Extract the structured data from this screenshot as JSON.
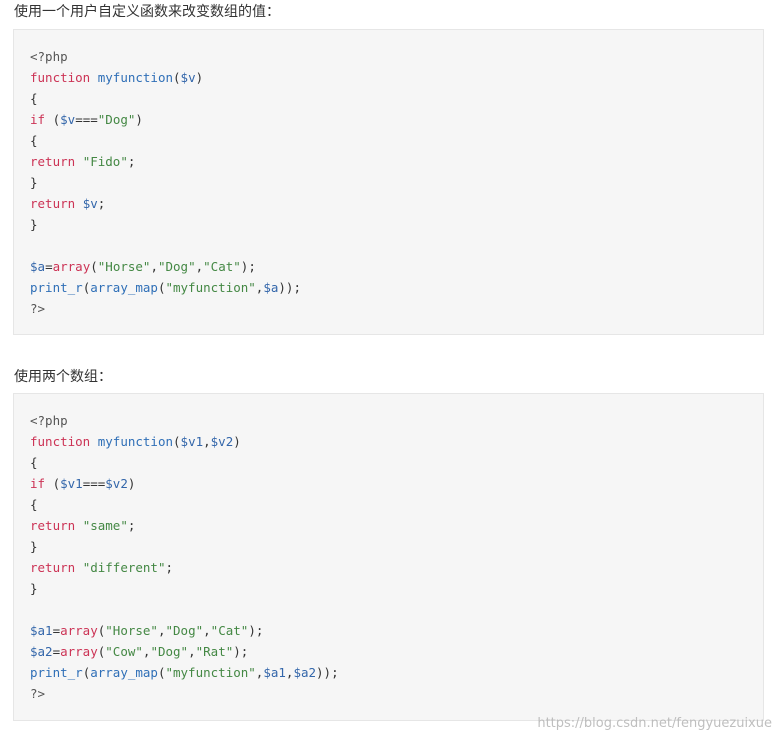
{
  "heading1": "使用一个用户自定义函数来改变数组的值：",
  "heading2": "使用两个数组：",
  "watermark": "https://blog.csdn.net/fengyuezuixue",
  "colors": {
    "keyword": "#cc3355",
    "function_name": "#2f6fb7",
    "variable": "#3366aa",
    "string": "#448844",
    "plain": "#333333",
    "code_background": "#f6f6f6"
  },
  "code1": [
    [
      {
        "t": "meta",
        "v": "<?php"
      }
    ],
    [
      {
        "t": "kw",
        "v": "function"
      },
      {
        "t": "plain",
        "v": " "
      },
      {
        "t": "fn",
        "v": "myfunction"
      },
      {
        "t": "plain",
        "v": "("
      },
      {
        "t": "var",
        "v": "$v"
      },
      {
        "t": "plain",
        "v": ")"
      }
    ],
    [
      {
        "t": "plain",
        "v": "{"
      }
    ],
    [
      {
        "t": "kw",
        "v": "if"
      },
      {
        "t": "plain",
        "v": " ("
      },
      {
        "t": "var",
        "v": "$v"
      },
      {
        "t": "plain",
        "v": "==="
      },
      {
        "t": "str",
        "v": "\"Dog\""
      },
      {
        "t": "plain",
        "v": ")"
      }
    ],
    [
      {
        "t": "plain",
        "v": "{"
      }
    ],
    [
      {
        "t": "kw",
        "v": "return"
      },
      {
        "t": "plain",
        "v": " "
      },
      {
        "t": "str",
        "v": "\"Fido\""
      },
      {
        "t": "plain",
        "v": ";"
      }
    ],
    [
      {
        "t": "plain",
        "v": "}"
      }
    ],
    [
      {
        "t": "kw",
        "v": "return"
      },
      {
        "t": "plain",
        "v": " "
      },
      {
        "t": "var",
        "v": "$v"
      },
      {
        "t": "plain",
        "v": ";"
      }
    ],
    [
      {
        "t": "plain",
        "v": "}"
      }
    ],
    [],
    [
      {
        "t": "var",
        "v": "$a"
      },
      {
        "t": "plain",
        "v": "="
      },
      {
        "t": "kw",
        "v": "array"
      },
      {
        "t": "plain",
        "v": "("
      },
      {
        "t": "str",
        "v": "\"Horse\""
      },
      {
        "t": "plain",
        "v": ","
      },
      {
        "t": "str",
        "v": "\"Dog\""
      },
      {
        "t": "plain",
        "v": ","
      },
      {
        "t": "str",
        "v": "\"Cat\""
      },
      {
        "t": "plain",
        "v": ");"
      }
    ],
    [
      {
        "t": "fn",
        "v": "print_r"
      },
      {
        "t": "plain",
        "v": "("
      },
      {
        "t": "fn",
        "v": "array_map"
      },
      {
        "t": "plain",
        "v": "("
      },
      {
        "t": "str",
        "v": "\"myfunction\""
      },
      {
        "t": "plain",
        "v": ","
      },
      {
        "t": "var",
        "v": "$a"
      },
      {
        "t": "plain",
        "v": "));"
      }
    ],
    [
      {
        "t": "meta",
        "v": "?>"
      }
    ]
  ],
  "code2": [
    [
      {
        "t": "meta",
        "v": "<?php"
      }
    ],
    [
      {
        "t": "kw",
        "v": "function"
      },
      {
        "t": "plain",
        "v": " "
      },
      {
        "t": "fn",
        "v": "myfunction"
      },
      {
        "t": "plain",
        "v": "("
      },
      {
        "t": "var",
        "v": "$v1"
      },
      {
        "t": "plain",
        "v": ","
      },
      {
        "t": "var",
        "v": "$v2"
      },
      {
        "t": "plain",
        "v": ")"
      }
    ],
    [
      {
        "t": "plain",
        "v": "{"
      }
    ],
    [
      {
        "t": "kw",
        "v": "if"
      },
      {
        "t": "plain",
        "v": " ("
      },
      {
        "t": "var",
        "v": "$v1"
      },
      {
        "t": "plain",
        "v": "==="
      },
      {
        "t": "var",
        "v": "$v2"
      },
      {
        "t": "plain",
        "v": ")"
      }
    ],
    [
      {
        "t": "plain",
        "v": "{"
      }
    ],
    [
      {
        "t": "kw",
        "v": "return"
      },
      {
        "t": "plain",
        "v": " "
      },
      {
        "t": "str",
        "v": "\"same\""
      },
      {
        "t": "plain",
        "v": ";"
      }
    ],
    [
      {
        "t": "plain",
        "v": "}"
      }
    ],
    [
      {
        "t": "kw",
        "v": "return"
      },
      {
        "t": "plain",
        "v": " "
      },
      {
        "t": "str",
        "v": "\"different\""
      },
      {
        "t": "plain",
        "v": ";"
      }
    ],
    [
      {
        "t": "plain",
        "v": "}"
      }
    ],
    [],
    [
      {
        "t": "var",
        "v": "$a1"
      },
      {
        "t": "plain",
        "v": "="
      },
      {
        "t": "kw",
        "v": "array"
      },
      {
        "t": "plain",
        "v": "("
      },
      {
        "t": "str",
        "v": "\"Horse\""
      },
      {
        "t": "plain",
        "v": ","
      },
      {
        "t": "str",
        "v": "\"Dog\""
      },
      {
        "t": "plain",
        "v": ","
      },
      {
        "t": "str",
        "v": "\"Cat\""
      },
      {
        "t": "plain",
        "v": ");"
      }
    ],
    [
      {
        "t": "var",
        "v": "$a2"
      },
      {
        "t": "plain",
        "v": "="
      },
      {
        "t": "kw",
        "v": "array"
      },
      {
        "t": "plain",
        "v": "("
      },
      {
        "t": "str",
        "v": "\"Cow\""
      },
      {
        "t": "plain",
        "v": ","
      },
      {
        "t": "str",
        "v": "\"Dog\""
      },
      {
        "t": "plain",
        "v": ","
      },
      {
        "t": "str",
        "v": "\"Rat\""
      },
      {
        "t": "plain",
        "v": ");"
      }
    ],
    [
      {
        "t": "fn",
        "v": "print_r"
      },
      {
        "t": "plain",
        "v": "("
      },
      {
        "t": "fn",
        "v": "array_map"
      },
      {
        "t": "plain",
        "v": "("
      },
      {
        "t": "str",
        "v": "\"myfunction\""
      },
      {
        "t": "plain",
        "v": ","
      },
      {
        "t": "var",
        "v": "$a1"
      },
      {
        "t": "plain",
        "v": ","
      },
      {
        "t": "var",
        "v": "$a2"
      },
      {
        "t": "plain",
        "v": "));"
      }
    ],
    [
      {
        "t": "meta",
        "v": "?>"
      }
    ]
  ]
}
